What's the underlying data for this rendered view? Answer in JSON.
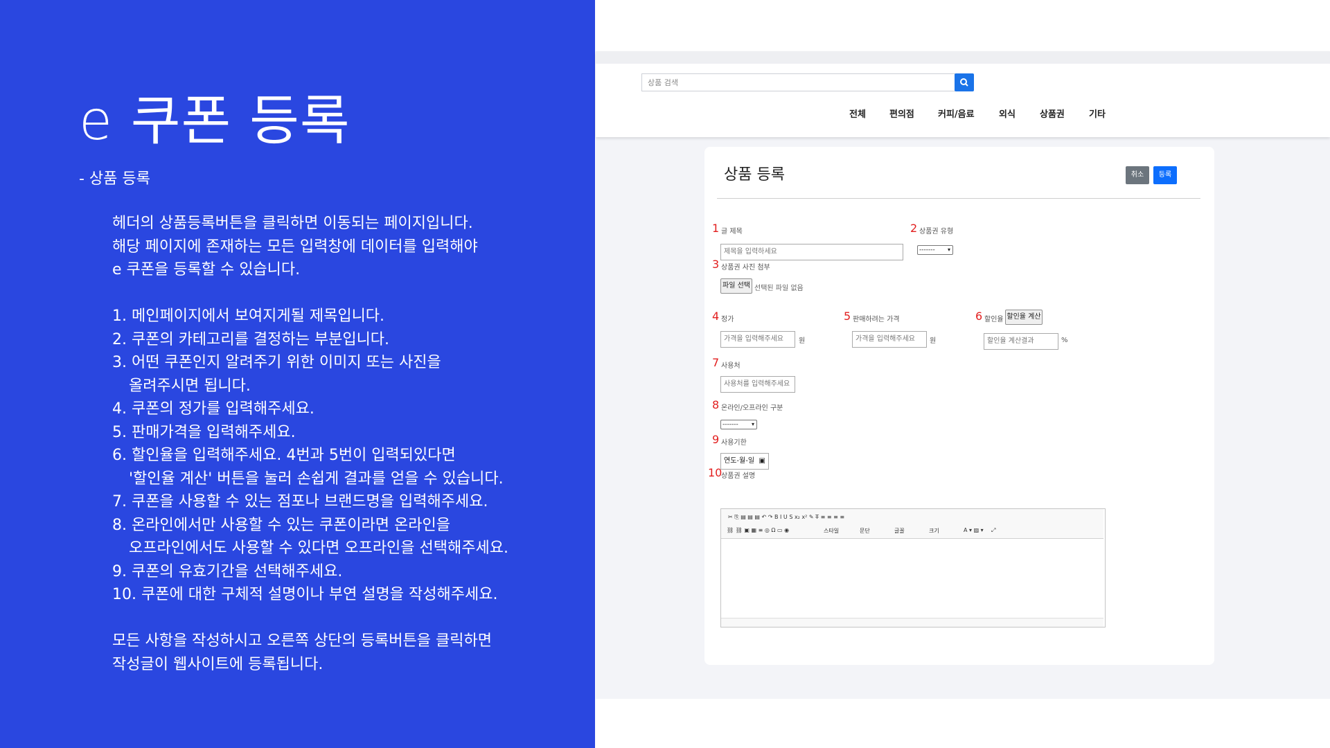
{
  "slide": {
    "title": "e 쿠폰 등록",
    "subtitle": "- 상품 등록",
    "intro": [
      "헤더의 상품등록버튼을 클릭하면 이동되는 페이지입니다.",
      "해당 페이지에 존재하는 모든 입력창에 데이터를 입력해야",
      "e 쿠폰을 등록할 수 있습니다."
    ],
    "steps": [
      "1. 메인페이지에서 보여지게될 제목입니다.",
      "2. 쿠폰의 카테고리를 결정하는 부분입니다.",
      "3. 어떤 쿠폰인지 알려주기 위한 이미지 또는 사진을",
      "올려주시면 됩니다.",
      "4. 쿠폰의 정가를 입력해주세요.",
      "5. 판매가격을 입력해주세요.",
      "6. 할인율을 입력해주세요. 4번과 5번이 입력되있다면",
      "'할인율 계산' 버튼을 눌러 손쉽게 결과를 얻을 수 있습니다.",
      "7. 쿠폰을 사용할 수 있는 점포나 브랜드명을 입력해주세요.",
      "8. 온라인에서만 사용할 수 있는 쿠폰이라면 온라인을",
      "오프라인에서도 사용할 수 있다면 오프라인을 선택해주세요.",
      "9. 쿠폰의 유효기간을 선택해주세요.",
      "10. 쿠폰에 대한 구체적 설명이나 부연 설명을 작성해주세요."
    ],
    "outro": [
      "모든 사항을 작성하시고 오른쪽 상단의 등록버튼을 클릭하면",
      "작성글이 웹사이트에 등록됩니다."
    ]
  },
  "site": {
    "search_placeholder": "상품 검색",
    "nav": [
      "전체",
      "편의점",
      "커피/음료",
      "외식",
      "상품권",
      "기타"
    ]
  },
  "form": {
    "heading": "상품 등록",
    "cancel": "취소",
    "submit": "등록",
    "numbers": [
      "1",
      "2",
      "3",
      "4",
      "5",
      "6",
      "7",
      "8",
      "9",
      "10"
    ],
    "title_label": "글 제목",
    "title_placeholder": "제목을 입력하세요",
    "type_label": "상품권 유형",
    "type_value": "-------",
    "photo_label": "상품권 사진 첨부",
    "file_button": "파일 선택",
    "file_status": "선택된 파일 없음",
    "price_label": "정가",
    "price_placeholder": "가격을 입력해주세요",
    "unit_won": "원",
    "sale_label": "판매하려는 가격",
    "sale_placeholder": "가격을 입력해주세요",
    "discount_label": "할인율",
    "discount_button": "할인율 계산",
    "discount_placeholder": "할인율 계산결과",
    "unit_percent": "%",
    "place_label": "사용처",
    "place_placeholder": "사용처를 입력해주세요",
    "online_label": "온라인/오프라인 구분",
    "online_value": "-------",
    "period_label": "사용기한",
    "period_value": "연도-월-일",
    "desc_label": "상품권 설명",
    "toolbar_row1": "✂  ⎘  ▤  ▤  ▤  ↶  ↷  B  I  U  S  x₂  x²  ✎  T̶  ≡  ≡  ≡  ≡",
    "toolbar_row2": "⛓  ⛓  ▣  ▦  ≡  ◎  Ω  ▭  ◉",
    "style_select": "스타일",
    "format_select": "문단",
    "font_select": "글꼴",
    "size_select": "크기"
  }
}
